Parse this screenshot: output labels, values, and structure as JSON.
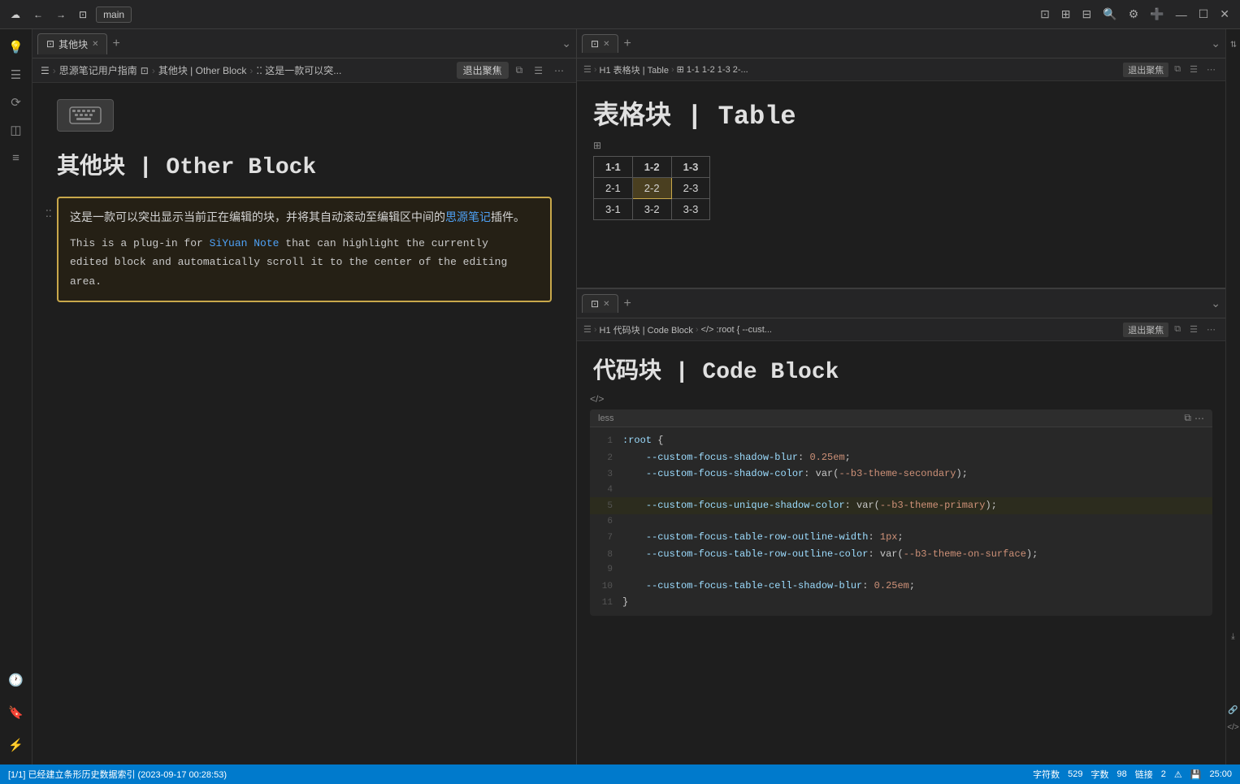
{
  "topbar": {
    "title": "main",
    "left_btn_back": "←",
    "left_btn_fwd": "→",
    "left_btn_save": "⊡",
    "left_btn_cloud": "☁",
    "right_buttons": [
      "⊡",
      "⊞",
      "⊟",
      "🔍",
      "⚙",
      "➕",
      "—",
      "☐",
      "✕"
    ]
  },
  "left_sidebar": {
    "icons": [
      {
        "name": "bulb",
        "glyph": "💡"
      },
      {
        "name": "doc",
        "glyph": "☰"
      },
      {
        "name": "sync",
        "glyph": "⟳"
      },
      {
        "name": "layers",
        "glyph": "◫"
      },
      {
        "name": "list2",
        "glyph": "≡"
      }
    ]
  },
  "left_panel": {
    "tab": {
      "icon": "⊡",
      "label": "其他块",
      "close": "✕"
    },
    "breadcrumb": {
      "doc_icon": "☰",
      "crumbs": [
        "思源笔记用户指南",
        "⊡",
        ">",
        "其他块 | Other Block",
        ">",
        "⁚⁚ 这是一款可以突..."
      ],
      "exit_focus_label": "退出聚焦",
      "copy_icon": "⧉",
      "doc_icon2": "☰",
      "more_icon": "⋯"
    },
    "content": {
      "doc_title": "其他块 | Other Block",
      "block_text_cn": "这是一款可以突出显示当前正在编辑的块，并将其自动滚动至编辑区中间的",
      "block_link_cn": "思源笔记",
      "block_text_cn2": "插件。",
      "block_text_en_1": "This is a plug-in for ",
      "block_link_en": "SiYuan Note",
      "block_text_en_2": " that can highlight the currently",
      "block_text_en_3": "edited block and automatically scroll it to the center of the editing",
      "block_text_en_4": "area."
    }
  },
  "right_top_panel": {
    "tab": {
      "icon": "⊡",
      "close": "✕"
    },
    "breadcrumb": {
      "doc_icon": "☰",
      "crumbs": [
        "H1 表格块 | Table",
        ">",
        "⊞ 1-1  1-2  1-3  2-..."
      ],
      "exit_focus_label": "退出聚焦",
      "copy_icon": "⧉",
      "doc_icon2": "☰",
      "more_icon": "⋯"
    },
    "content": {
      "title": "表格块 | Table",
      "table": {
        "headers": [
          "1-1",
          "1-2",
          "1-3"
        ],
        "rows": [
          [
            "2-1",
            "2-2",
            "2-3"
          ],
          [
            "3-1",
            "3-2",
            "3-3"
          ]
        ],
        "highlighted_row": 0,
        "highlighted_col": 1
      }
    }
  },
  "right_bottom_panel": {
    "tab": {
      "icon": "⊡",
      "close": "✕"
    },
    "breadcrumb": {
      "doc_icon": "☰",
      "crumbs": [
        "H1 代码块 | Code Block",
        ">",
        "</> :root { --cust..."
      ],
      "exit_focus_label": "退出聚焦",
      "copy_icon": "⧉",
      "doc_icon2": "☰",
      "more_icon": "⋯"
    },
    "content": {
      "title": "代码块 | Code Block",
      "lang": "less",
      "lines": [
        {
          "num": 1,
          "code": ":root {",
          "highlighted": false
        },
        {
          "num": 2,
          "code": "    --custom-focus-shadow-blur: 0.25em;",
          "highlighted": false
        },
        {
          "num": 3,
          "code": "    --custom-focus-shadow-color: var(--b3-theme-secondary);",
          "highlighted": false
        },
        {
          "num": 4,
          "code": "",
          "highlighted": false
        },
        {
          "num": 5,
          "code": "    --custom-focus-unique-shadow-color: var(--b3-theme-primary);",
          "highlighted": true
        },
        {
          "num": 6,
          "code": "",
          "highlighted": false
        },
        {
          "num": 7,
          "code": "    --custom-focus-table-row-outline-width: 1px;",
          "highlighted": false
        },
        {
          "num": 8,
          "code": "    --custom-focus-table-row-outline-color: var(--b3-theme-on-surface);",
          "highlighted": false
        },
        {
          "num": 9,
          "code": "",
          "highlighted": false
        },
        {
          "num": 10,
          "code": "    --custom-focus-table-cell-shadow-blur: 0.25em;",
          "highlighted": false
        },
        {
          "num": 11,
          "code": "}",
          "highlighted": false
        }
      ]
    }
  },
  "status_bar": {
    "left": "[1/1] 已经建立条形历史数据索引 (2023-09-17 00:28:53)",
    "char_count_label": "字符数",
    "char_count": "529",
    "word_count_label": "字数",
    "word_count": "98",
    "link_count_label": "链接",
    "link_count": "2",
    "warn_icon": "⚠",
    "save_icon": "💾",
    "time": "25:00"
  },
  "code_block_tag": "</>",
  "table_block_tag": "⊞"
}
